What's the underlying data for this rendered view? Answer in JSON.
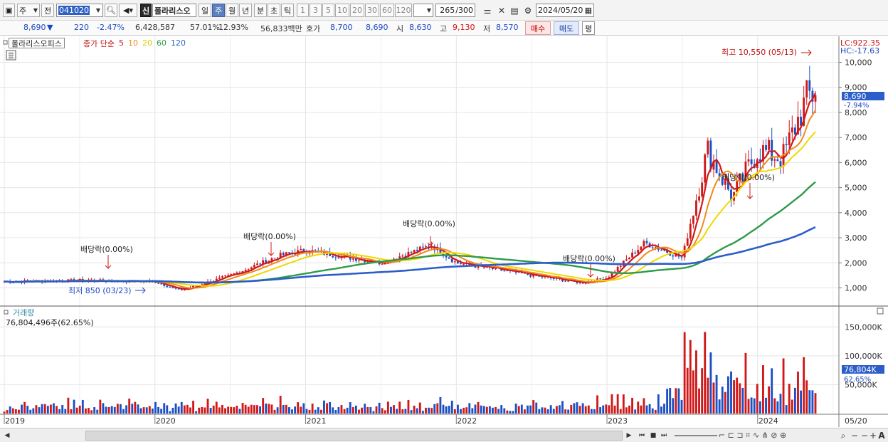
{
  "toolbar": {
    "type_select": "주",
    "prev_btn": "전",
    "stock_code": "041020",
    "mode_new": "신",
    "stock_name": "폴라리스오",
    "periods": [
      "일",
      "주",
      "월",
      "년",
      "분",
      "초",
      "틱"
    ],
    "active_period": "주",
    "intervals": [
      "1",
      "3",
      "5",
      "10",
      "20",
      "30",
      "60",
      "120"
    ],
    "count": "265",
    "count_total": "/300",
    "date": "2024/05/20"
  },
  "quote": {
    "price": "8,690",
    "change_arrow": "▼",
    "change": "220",
    "change_pct": "-2.47%",
    "volume": "6,428,587",
    "vol_ratio": "57.01%",
    "turnover": "12.93%",
    "amount": "56,833백만",
    "bid_label": "호가",
    "bid1": "8,700",
    "bid2": "8,690",
    "open_label": "시",
    "open": "8,630",
    "high_label": "고",
    "high": "9,130",
    "low_label": "저",
    "low": "8,570",
    "buy": "매수",
    "sell": "매도",
    "eval": "평"
  },
  "legend": {
    "stock": "폴라리스오피스",
    "ma_label": "종가 단순",
    "ma": [
      {
        "period": "5",
        "color": "#d01818"
      },
      {
        "period": "10",
        "color": "#f08a1c"
      },
      {
        "period": "20",
        "color": "#f0d800"
      },
      {
        "period": "60",
        "color": "#2e9a4a"
      },
      {
        "period": "120",
        "color": "#2c5ec9"
      }
    ]
  },
  "price_panel": {
    "lc": "LC:922.35",
    "hc": "HC:-17.63",
    "y_ticks": [
      "10,000",
      "9,000",
      "8,000",
      "7,000",
      "6,000",
      "5,000",
      "4,000",
      "3,000",
      "2,000",
      "1,000"
    ],
    "current_price": "8,690",
    "current_pct": "-7.94%",
    "high_note": "최고 10,550 (05/13)",
    "low_note": "최저 850 (03/23)",
    "dividend_notes": [
      "배당락(0.00%)",
      "배당락(0.00%)",
      "배당락(0.00%)",
      "배당락(0.00%)",
      "배당락(0.00%)"
    ]
  },
  "volume_panel": {
    "title": "거래량",
    "summary": "76,804,496주(62.65%)",
    "y_ticks": [
      "150,000K",
      "100,000K",
      "50,000K"
    ],
    "current": "76,804K",
    "current_pct": "62.65%"
  },
  "x_axis": {
    "labels": [
      "2019",
      "2020",
      "2021",
      "2022",
      "2023",
      "2024"
    ],
    "last": "05/20"
  },
  "chart_data": {
    "type": "candlestick",
    "period": "weekly",
    "x": [
      "2019-01",
      "2019-07",
      "2020-01",
      "2020-03",
      "2020-07",
      "2020-11",
      "2021-01",
      "2021-07",
      "2021-11",
      "2022-01",
      "2022-07",
      "2022-11",
      "2023-01",
      "2023-04",
      "2023-07",
      "2023-09",
      "2023-11",
      "2024-01",
      "2024-03",
      "2024-05"
    ],
    "close": [
      1250,
      1300,
      1250,
      900,
      1500,
      2300,
      2500,
      2000,
      2700,
      2000,
      1500,
      1200,
      1400,
      2800,
      2200,
      6500,
      4600,
      6500,
      6200,
      8690
    ],
    "ylim": [
      500,
      10800
    ],
    "y_ticks": [
      1000,
      2000,
      3000,
      4000,
      5000,
      6000,
      7000,
      8000,
      9000,
      10000
    ],
    "high": 10550,
    "low": 850,
    "volume_ylim": [
      0,
      175000
    ]
  },
  "colors": {
    "up": "#d01818",
    "down": "#1c4fc4"
  }
}
